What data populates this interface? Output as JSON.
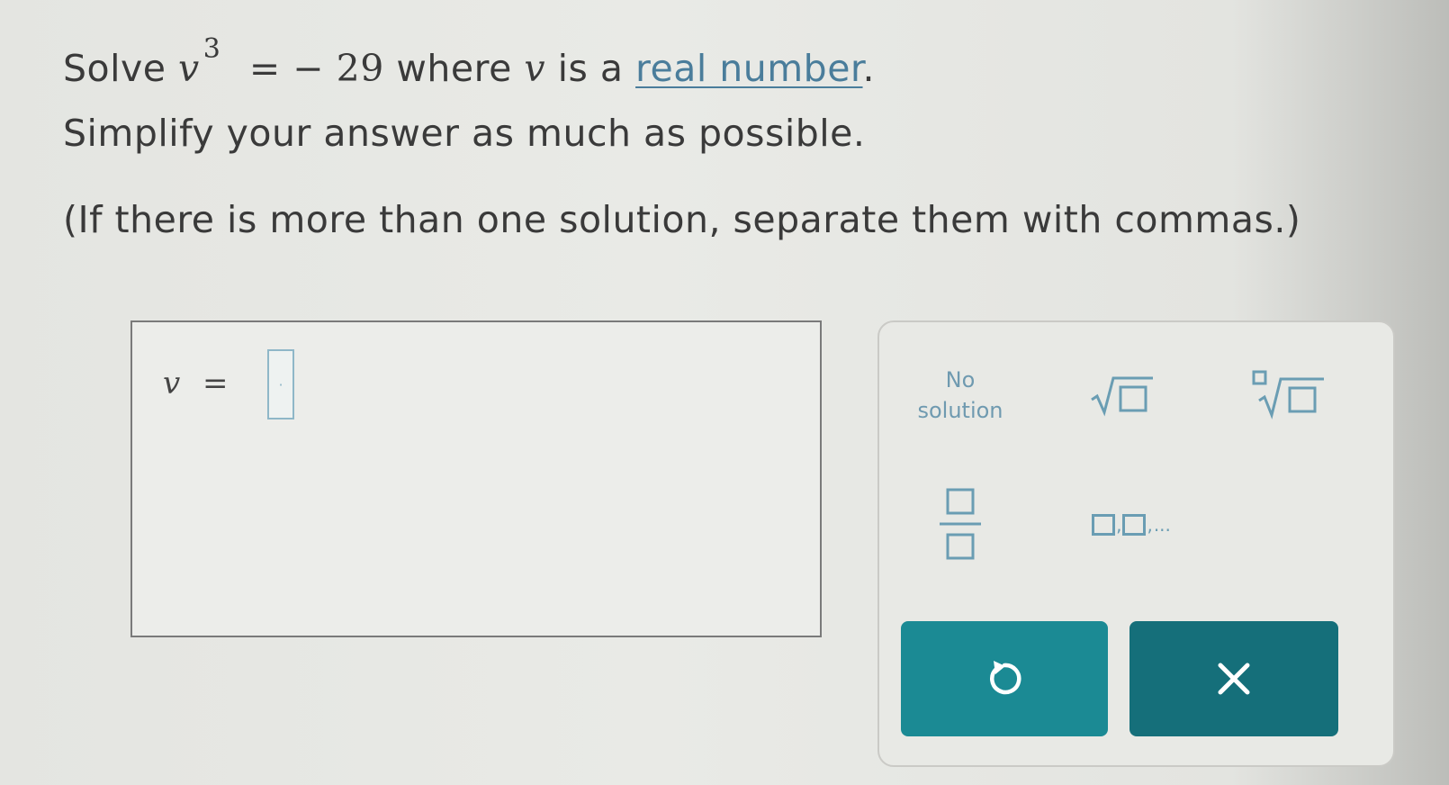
{
  "question": {
    "solve_word": "Solve",
    "variable": "v",
    "exponent": "3",
    "equals": "=",
    "rhs": "− 29",
    "where_text": "where",
    "var_inline": "v",
    "is_a_text": "is a",
    "link_text": "real number",
    "period": ".",
    "line2": "Simplify your answer as much as possible.",
    "line3": "(If there is more than one solution, separate them with commas.)"
  },
  "answer": {
    "variable": "v",
    "equals": "=",
    "input_value": "",
    "cursor_glyph": "·"
  },
  "keypad": {
    "no_solution_line1": "No",
    "no_solution_line2": "solution",
    "sqrt_icon": "square-root-icon",
    "nthroot_icon": "nth-root-icon",
    "fraction_icon": "fraction-icon",
    "list_icon": "list-separator-icon",
    "list_ellipsis": "...",
    "list_comma": ","
  },
  "buttons": {
    "reset_icon": "reset-icon",
    "clear_symbol": "×"
  },
  "colors": {
    "link": "#4a7d9b",
    "key_icon": "#6a9db3",
    "reset_button": "#1b8a94",
    "clear_button": "#156f7a"
  }
}
